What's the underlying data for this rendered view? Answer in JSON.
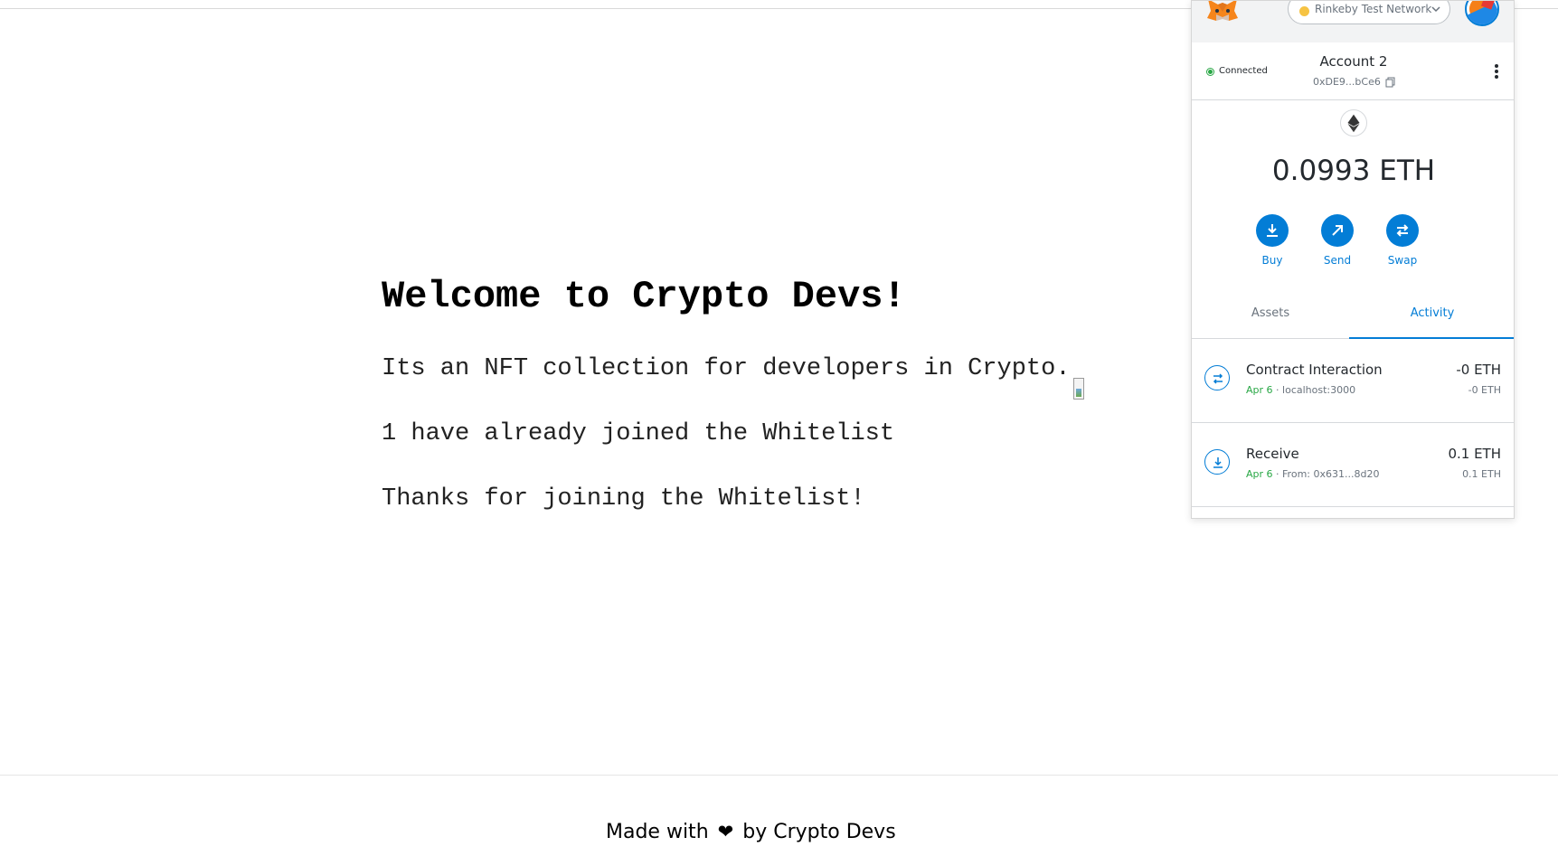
{
  "page": {
    "title": "Welcome to Crypto Devs!",
    "description": "Its an NFT collection for developers in Crypto.",
    "joined_count_text": "1 have already joined the Whitelist",
    "thanks_text": "Thanks for joining the Whitelist!",
    "footer": {
      "prefix": "Made with",
      "heart": "❤",
      "suffix": "by Crypto Devs"
    }
  },
  "wallet": {
    "network": "Rinkeby Test Network",
    "connection_status": "Connected",
    "account_name": "Account 2",
    "account_address": "0xDE9...bCe6",
    "balance": "0.0993 ETH",
    "actions": [
      {
        "label": "Buy",
        "icon": "download-icon"
      },
      {
        "label": "Send",
        "icon": "arrow-up-right-icon"
      },
      {
        "label": "Swap",
        "icon": "swap-icon"
      }
    ],
    "tabs": [
      "Assets",
      "Activity"
    ],
    "active_tab": "Activity",
    "transactions": [
      {
        "title": "Contract Interaction",
        "date": "Apr 6",
        "detail": "localhost:3000",
        "amount": "-0 ETH",
        "amount_sub": "-0 ETH",
        "icon": "swap-icon"
      },
      {
        "title": "Receive",
        "date": "Apr 6",
        "detail": "From: 0x631...8d20",
        "amount": "0.1 ETH",
        "amount_sub": "0.1 ETH",
        "icon": "download-icon"
      }
    ],
    "colors": {
      "accent": "#037dd6",
      "connected": "#28a745",
      "network_dot": "#f6c343"
    }
  }
}
